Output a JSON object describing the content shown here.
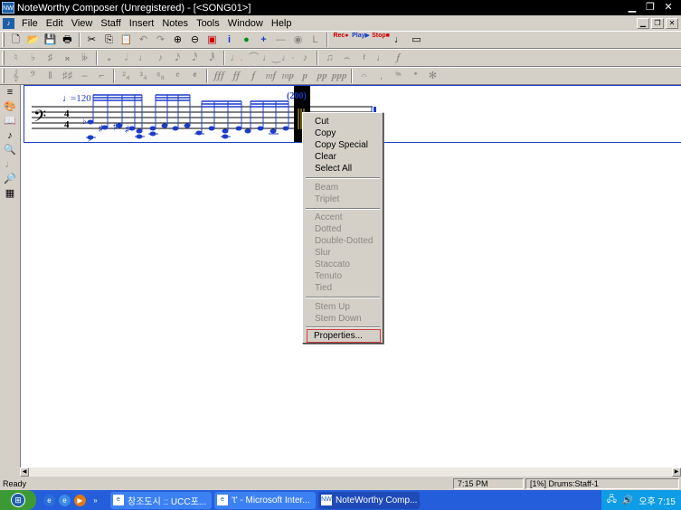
{
  "titlebar": {
    "title": "NoteWorthy Composer (Unregistered) - [<SONG01>]",
    "app_icon": "nw-app-icon"
  },
  "menubar": {
    "items": [
      "File",
      "Edit",
      "View",
      "Staff",
      "Insert",
      "Notes",
      "Tools",
      "Window",
      "Help"
    ]
  },
  "toolbar": {
    "play_labels": {
      "rec": "Rec",
      "play": "Play",
      "stop": "Stop"
    }
  },
  "score": {
    "tempo": "=120",
    "time_sig_top": "4",
    "time_sig_bottom": "4",
    "dynamic_marker": "(200)",
    "accent_color": "#1d3cc8",
    "selection_color": "#000000",
    "selection_mark_color": "#e0c020"
  },
  "context_menu": {
    "items": [
      {
        "label": "Cut",
        "enabled": true
      },
      {
        "label": "Copy",
        "enabled": true
      },
      {
        "label": "Copy Special",
        "enabled": true
      },
      {
        "label": "Clear",
        "enabled": true
      },
      {
        "label": "Select All",
        "enabled": true
      },
      {
        "label": "Beam",
        "enabled": false
      },
      {
        "label": "Triplet",
        "enabled": false
      },
      {
        "label": "Accent",
        "enabled": false
      },
      {
        "label": "Dotted",
        "enabled": false
      },
      {
        "label": "Double-Dotted",
        "enabled": false
      },
      {
        "label": "Slur",
        "enabled": false
      },
      {
        "label": "Staccato",
        "enabled": false
      },
      {
        "label": "Tenuto",
        "enabled": false
      },
      {
        "label": "Tied",
        "enabled": false
      },
      {
        "label": "Stem Up",
        "enabled": false
      },
      {
        "label": "Stem Down",
        "enabled": false
      },
      {
        "label": "Properties...",
        "enabled": true,
        "highlighted": true
      }
    ]
  },
  "statusbar": {
    "ready": "Ready",
    "time": "7:15 PM",
    "staff_info": "[1%] Drums:Staff-1"
  },
  "taskbar": {
    "buttons": [
      {
        "label": "창조도시 :: UCC포...",
        "active": false
      },
      {
        "label": "'t' - Microsoft Inter...",
        "active": false
      },
      {
        "label": "NoteWorthy Comp...",
        "active": true
      }
    ],
    "clock": "오후 7:15",
    "quicklaunch_chevron": "»"
  }
}
